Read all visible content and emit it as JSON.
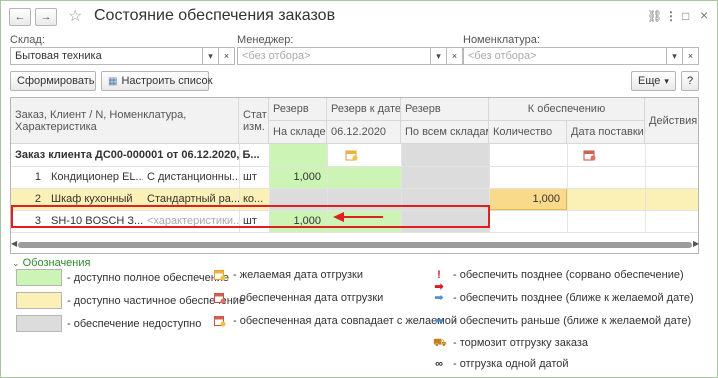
{
  "window": {
    "title": "Состояние обеспечения заказов",
    "back_icon": "←",
    "forward_icon": "→",
    "link_icon": "⛓",
    "menu_icon": "⋮",
    "maximize_icon": "□",
    "close_icon": "×"
  },
  "filters": {
    "warehouse_label": "Склад:",
    "warehouse_value": "Бытовая техника",
    "manager_label": "Менеджер:",
    "manager_placeholder": "<без отбора>",
    "nomenclature_label": "Номенклатура:",
    "nomenclature_placeholder": "<без отбора>"
  },
  "toolbar": {
    "form_label": "Сформировать",
    "configure_label": "Настроить список",
    "more_label": "Еще",
    "help_label": "?"
  },
  "table": {
    "headers": {
      "order": "Заказ, Клиент / N, Номенклатура,",
      "order2": "Характеристика",
      "status": "Стат",
      "status2": "изм.",
      "reserve": "Резерв",
      "on_stock": "На складе",
      "reserve_by_date": "Резерв к дате",
      "date_value": "06.12.2020",
      "reserve_all": "Резерв",
      "all_stocks": "По всем складам",
      "to_provide": "К обеспечению",
      "quantity": "Количество",
      "delivery_date": "Дата поставки",
      "actions": "Действия"
    },
    "group_row": {
      "label": "Заказ клиента ДС00-000001 от 06.12.2020, Б..."
    },
    "rows": [
      {
        "n": "1",
        "item": "Кондиционер EL...",
        "char": "С дистанционны...",
        "unit": "шт",
        "on_stock": "1,000",
        "to_provide": ""
      },
      {
        "n": "2",
        "item": "Шкаф кухонный",
        "char": "Стандартный ра...",
        "unit": "ко...",
        "on_stock": "",
        "to_provide": "1,000"
      },
      {
        "n": "3",
        "item": "SH-10 BOSCH З...",
        "char": "<характеристики...",
        "unit": "шт",
        "on_stock": "1,000",
        "to_provide": ""
      }
    ]
  },
  "legend": {
    "title": "Обозначения",
    "full": "- доступно полное обеспечение",
    "partial": "- доступно частичное обеспечение",
    "unavailable": "- обеспечение недоступно",
    "desired_date": "- желаемая дата отгрузки",
    "provided_date": "- обеспеченная дата отгрузки",
    "matches": "- обеспеченная дата совпадает с желаемой",
    "later_broken": "- обеспечить позднее (сорвано обеспечение)",
    "later_closer": "- обеспечить позднее (ближе к желаемой дате)",
    "earlier_closer": "- обеспечить раньше (ближе к желаемой дате)",
    "slows": "- тормозит отгрузку заказа",
    "one_date": "- отгрузка одной датой"
  },
  "colors": {
    "full": "#ccf5b5",
    "partial": "#fbf1b6",
    "unavailable": "#dcdcdc",
    "highlight": "#e02020"
  }
}
